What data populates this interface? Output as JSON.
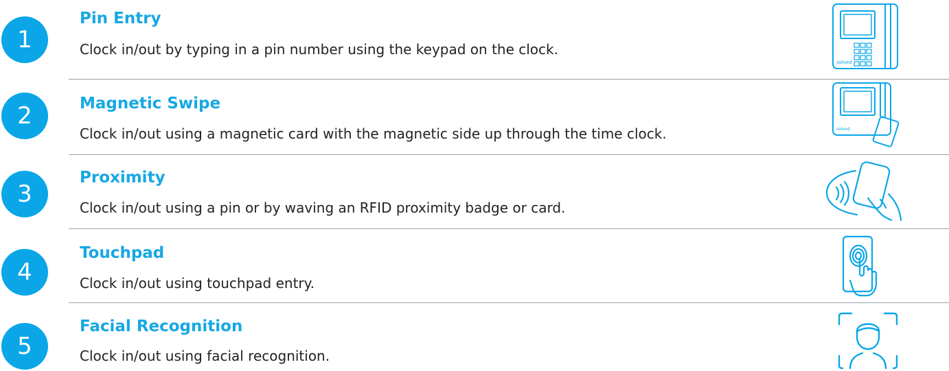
{
  "accent_color": "#0aa6e8",
  "items": [
    {
      "number": "1",
      "title": "Pin Entry",
      "description": "Clock in/out by typing in a pin number using the keypad on the clock.",
      "icon": "keypad-clock-icon",
      "brand": "solved"
    },
    {
      "number": "2",
      "title": "Magnetic Swipe",
      "description": "Clock in/out using a magnetic card with the magnetic side up through the time clock.",
      "icon": "swipe-clock-icon",
      "brand": "solved"
    },
    {
      "number": "3",
      "title": "Proximity",
      "description": "Clock in/out using a pin or by waving an RFID proximity badge or card.",
      "icon": "proximity-card-icon"
    },
    {
      "number": "4",
      "title": "Touchpad",
      "description": "Clock in/out using touchpad entry.",
      "icon": "fingerprint-touch-icon"
    },
    {
      "number": "5",
      "title": "Facial Recognition",
      "description": "Clock in/out using facial recognition.",
      "icon": "face-scan-icon"
    }
  ]
}
